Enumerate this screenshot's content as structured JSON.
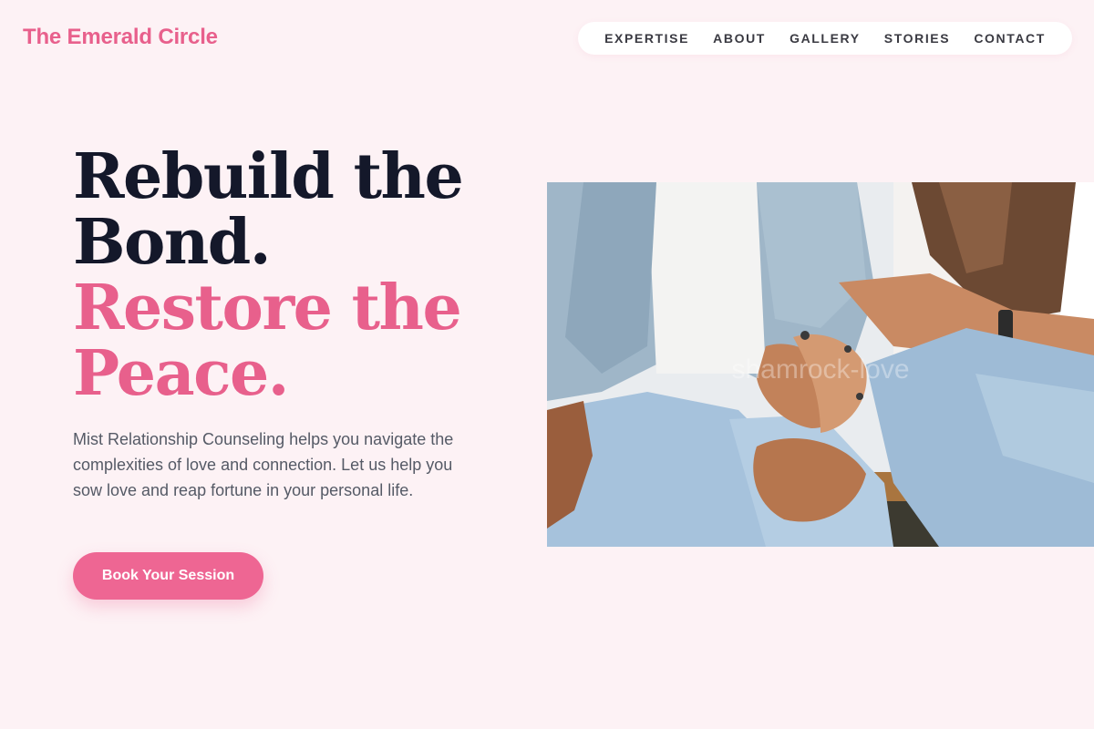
{
  "header": {
    "brand": "The Emerald Circle",
    "nav": [
      {
        "label": "EXPERTISE"
      },
      {
        "label": "ABOUT"
      },
      {
        "label": "GALLERY"
      },
      {
        "label": "STORIES"
      },
      {
        "label": "CONTACT"
      }
    ]
  },
  "hero": {
    "headline_line1": "Rebuild the",
    "headline_line2": "Bond.",
    "headline_line3": "Restore the",
    "headline_line4": "Peace.",
    "intro": "Mist Relationship Counseling helps you navigate the complexities of love and connection. Let us help you sow love and reap fortune in your personal life.",
    "cta_label": "Book Your Session",
    "image_watermark": "shamrock-love"
  },
  "colors": {
    "accent": "#e8608c",
    "button": "#ee6693",
    "heading_dark": "#14182a",
    "background": "#fdf2f5"
  }
}
